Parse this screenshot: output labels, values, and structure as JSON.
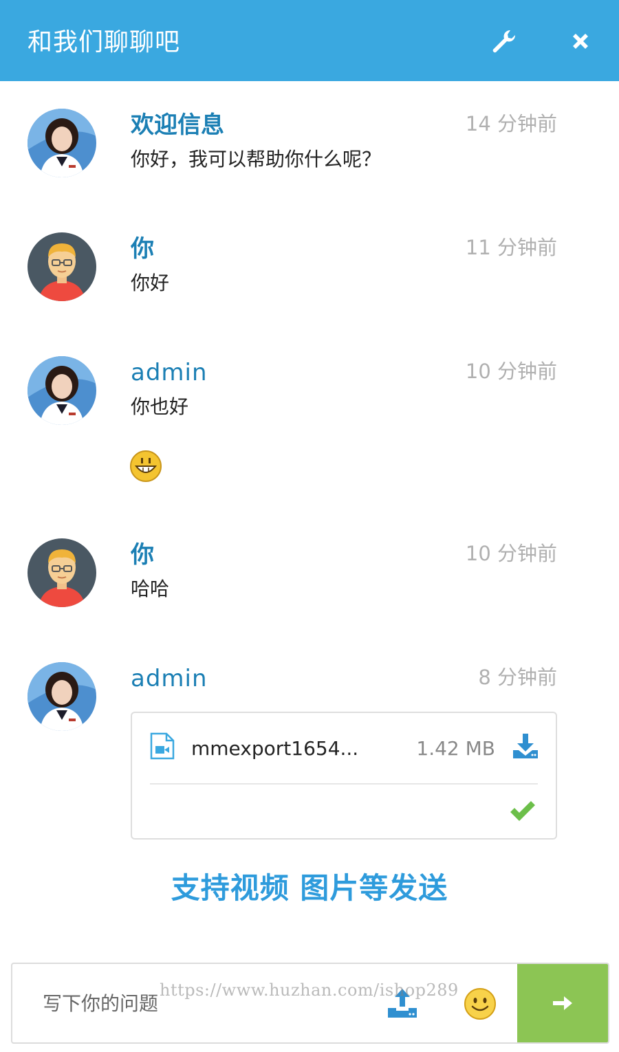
{
  "header": {
    "title": "和我们聊聊吧",
    "settings_icon": "wrench-icon",
    "close_icon": "close-icon",
    "background": "#3aa8e0"
  },
  "messages": [
    {
      "sender": "欢迎信息",
      "time": "14 分钟前",
      "text": "你好，我可以帮助你什么呢？",
      "avatar": "agent-avatar"
    },
    {
      "sender": "你",
      "time": "11 分钟前",
      "text": "你好",
      "avatar": "user-avatar"
    },
    {
      "sender": "admin",
      "time": "10 分钟前",
      "text": "你也好",
      "avatar": "agent-avatar",
      "emoji": "grin-emoji-icon"
    },
    {
      "sender": "你",
      "time": "10 分钟前",
      "text": "哈哈",
      "avatar": "user-avatar"
    },
    {
      "sender": "admin",
      "time": "8 分钟前",
      "avatar": "agent-avatar",
      "file": {
        "name": "mmexport1654...",
        "size": "1.42 MB",
        "type_icon": "video-file-icon",
        "download_icon": "download-icon",
        "status_icon": "check-icon"
      }
    }
  ],
  "promo_text": "支持视频 图片等发送",
  "composer": {
    "placeholder": "写下你的问题",
    "upload_icon": "upload-icon",
    "emoji_icon": "smiley-icon",
    "send_icon": "arrow-right-icon",
    "send_color": "#8cc554"
  },
  "watermark": "https://www.huzhan.com/ishop289",
  "colors": {
    "accent": "#3aa8e0",
    "sender": "#1b7fb4",
    "time": "#b0b0b0",
    "promo": "#2e9bdc"
  }
}
